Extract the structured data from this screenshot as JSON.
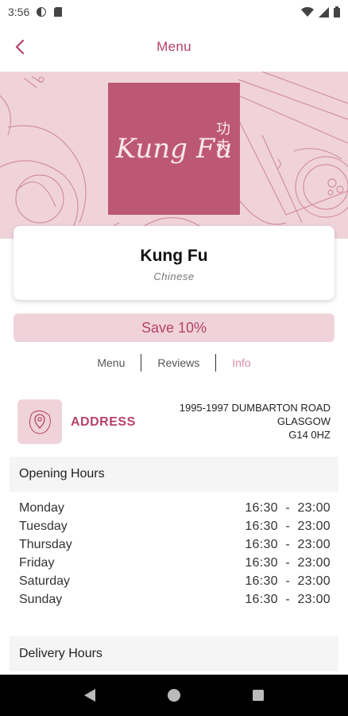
{
  "status_bar": {
    "time": "3:56"
  },
  "header": {
    "title": "Menu"
  },
  "restaurant": {
    "logo_text": "Kung Fu",
    "logo_chinese_1": "功",
    "logo_chinese_2": "夫",
    "name": "Kung Fu",
    "cuisine": "Chinese"
  },
  "promo": {
    "label": "Save 10%"
  },
  "tabs": [
    {
      "label": "Menu"
    },
    {
      "label": "Reviews"
    },
    {
      "label": "Info"
    }
  ],
  "address": {
    "label": "ADDRESS",
    "line1": "1995-1997 DUMBARTON ROAD",
    "line2": "GLASGOW",
    "line3": "G14 0HZ"
  },
  "opening_hours": {
    "title": "Opening Hours",
    "rows": [
      {
        "day": "Monday",
        "time": "16:30  -  23:00"
      },
      {
        "day": "Tuesday",
        "time": "16:30  -  23:00"
      },
      {
        "day": "Thursday",
        "time": "16:30  -  23:00"
      },
      {
        "day": "Friday",
        "time": "16:30  -  23:00"
      },
      {
        "day": "Saturday",
        "time": "16:30  -  23:00"
      },
      {
        "day": "Sunday",
        "time": "16:30  -  23:00"
      }
    ]
  },
  "delivery_hours": {
    "title": "Delivery Hours"
  },
  "colors": {
    "accent": "#b5426a",
    "logo_bg": "#bd5874",
    "pink_light": "#f0d3da",
    "tab_active": "#d98ca6"
  },
  "icons": {
    "back": "chevron-left-icon",
    "address": "map-pin-icon",
    "nav_back": "triangle-back-icon",
    "nav_home": "circle-home-icon",
    "nav_recents": "square-recents-icon"
  }
}
